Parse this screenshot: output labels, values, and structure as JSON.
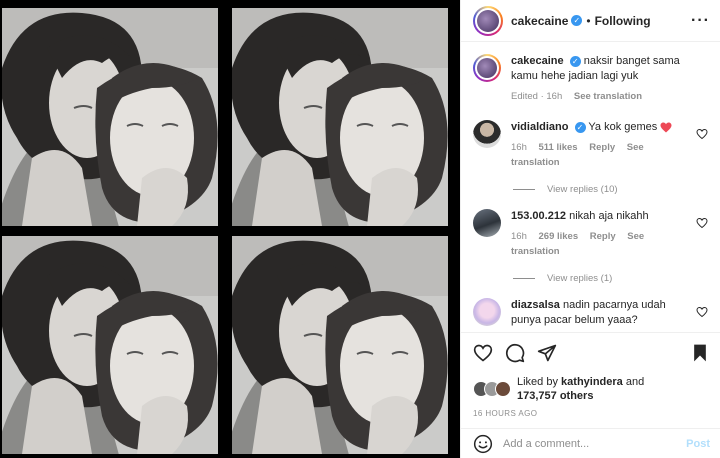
{
  "post": {
    "author": "cakecaine",
    "header_separator": "•",
    "follow_status": "Following",
    "more_icon": "more-horizontal-icon"
  },
  "caption": {
    "author": "cakecaine",
    "text": "naksir banget sama kamu hehe jadian lagi yuk",
    "edited": "Edited",
    "time": "16h",
    "see_translation": "See translation"
  },
  "comments": [
    {
      "author": "vidialdiano",
      "verified": true,
      "text": "Ya kok gemes",
      "emoji": "heart",
      "time": "16h",
      "likes": "511 likes",
      "reply": "Reply",
      "see_translation": "See translation",
      "view_replies": "View replies (10)"
    },
    {
      "author": "153.00.212",
      "verified": false,
      "text": "nikah aja nikahh",
      "time": "16h",
      "likes": "269 likes",
      "reply": "Reply",
      "see_translation": "See translation",
      "view_replies": "View replies (1)"
    },
    {
      "author": "diazsalsa",
      "verified": false,
      "text": "nadin pacarnya udah punya pacar belum yaaa?"
    }
  ],
  "actions": {
    "like_icon": "heart-icon",
    "comment_icon": "comment-icon",
    "share_icon": "share-icon",
    "save_icon": "bookmark-icon"
  },
  "likes": {
    "prefix": "Liked by",
    "user": "kathyindera",
    "and": "and",
    "others": "173,757 others"
  },
  "timestamp": "16 HOURS AGO",
  "add_comment": {
    "placeholder": "Add a comment...",
    "post_label": "Post"
  },
  "colors": {
    "verified": "#3897f0",
    "heart": "#ed4956",
    "post_disabled": "#b2dffc",
    "muted": "#8e8e8e"
  }
}
